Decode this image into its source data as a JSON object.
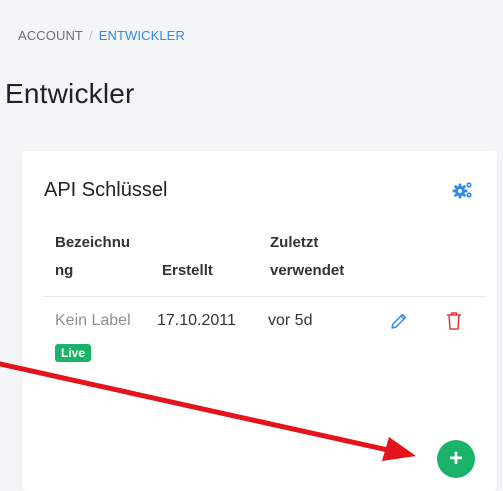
{
  "breadcrumb": {
    "root": "ACCOUNT",
    "separator": "/",
    "current": "ENTWICKLER"
  },
  "page": {
    "title": "Entwickler"
  },
  "card": {
    "title": "API Schlüssel",
    "settings_icon": "gears-icon",
    "columns": {
      "name_line1": "Bezeichnu",
      "name_line2": "ng",
      "created": "Erstellt",
      "used_line1": "Zuletzt",
      "used_line2": "verwendet"
    },
    "rows": [
      {
        "label": "Kein Label",
        "badge": "Live",
        "created": "17.10.2011",
        "last_used": "vor 5d"
      }
    ],
    "add_label": "+"
  },
  "colors": {
    "accent": "#2f8be6",
    "success": "#1bb36a",
    "danger": "#e0393e",
    "annotation": "#e3141b"
  }
}
